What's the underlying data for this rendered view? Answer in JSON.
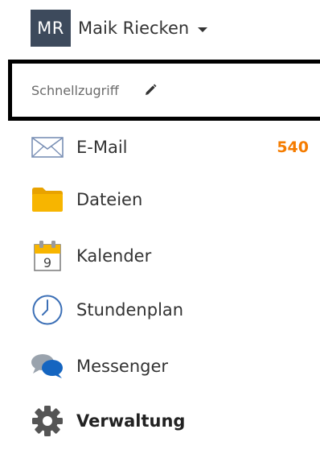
{
  "user": {
    "initials": "MR",
    "name": "Maik Riecken",
    "menu_icon": "caret-down-icon"
  },
  "quick_access": {
    "label": "Schnellzugriff",
    "edit_icon": "pencil-icon"
  },
  "nav": {
    "items": [
      {
        "label": "E-Mail",
        "icon": "envelope-icon",
        "badge": "540"
      },
      {
        "label": "Dateien",
        "icon": "folder-icon"
      },
      {
        "label": "Kalender",
        "icon": "calendar-icon",
        "icon_text": "9"
      },
      {
        "label": "Stundenplan",
        "icon": "clock-icon"
      },
      {
        "label": "Messenger",
        "icon": "chat-bubbles-icon"
      },
      {
        "label": "Verwaltung",
        "icon": "gear-icon",
        "bold": true
      }
    ]
  },
  "colors": {
    "avatar_bg": "#3d4a5c",
    "badge": "#f57c00",
    "folder": "#f7b500",
    "calendar_top": "#f7b500",
    "messenger_blue": "#1565c0",
    "gear": "#555555"
  }
}
